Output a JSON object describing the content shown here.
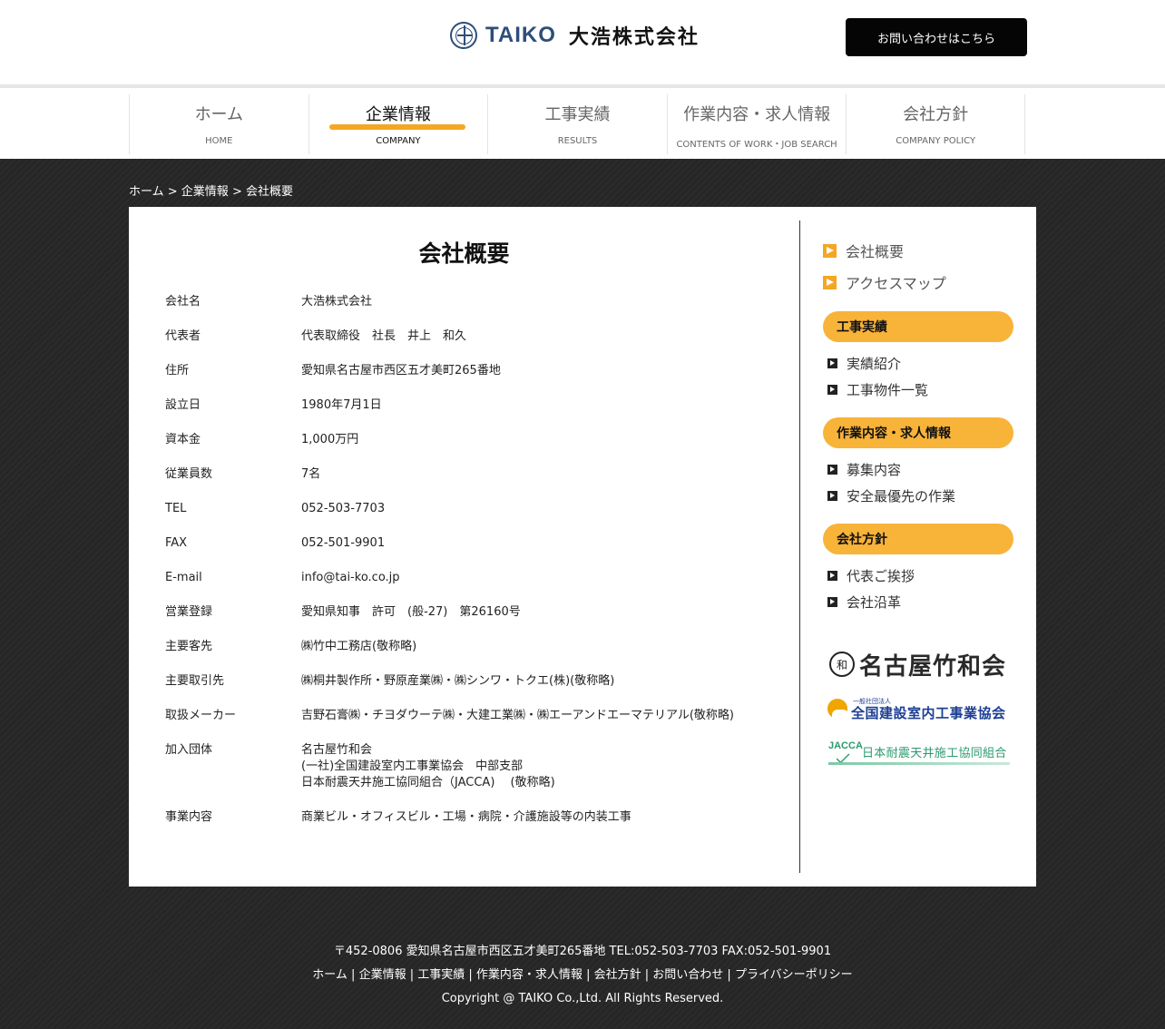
{
  "header": {
    "logo_en": "TAIKO",
    "logo_jp": "大浩株式会社",
    "contact_label": "お問い合わせはこちら"
  },
  "nav": [
    {
      "jp": "ホーム",
      "en": "HOME",
      "active": false
    },
    {
      "jp": "企業情報",
      "en": "COMPANY",
      "active": true
    },
    {
      "jp": "工事実績",
      "en": "RESULTS",
      "active": false
    },
    {
      "jp": "作業内容・求人情報",
      "en": "CONTENTS OF WORK・JOB SEARCH",
      "active": false
    },
    {
      "jp": "会社方針",
      "en": "COMPANY POLICY",
      "active": false
    }
  ],
  "breadcrumb": {
    "home": "ホーム",
    "sep1": " > ",
    "company": "企業情報",
    "sep2": " > ",
    "current": "会社概要"
  },
  "main": {
    "title": "会社概要",
    "rows": [
      {
        "key": "会社名",
        "value": "大浩株式会社"
      },
      {
        "key": "代表者",
        "value": "代表取締役　社長　井上　和久"
      },
      {
        "key": "住所",
        "value": "愛知県名古屋市西区五才美町265番地"
      },
      {
        "key": "設立日",
        "value": "1980年7月1日"
      },
      {
        "key": "資本金",
        "value": "1,000万円"
      },
      {
        "key": "従業員数",
        "value": "7名"
      },
      {
        "key": "TEL",
        "value": "052-503-7703"
      },
      {
        "key": "FAX",
        "value": "052-501-9901"
      },
      {
        "key": "E-mail",
        "value": "info@tai-ko.co.jp"
      },
      {
        "key": "営業登録",
        "value": "愛知県知事　許可　(般-27)　第26160号"
      },
      {
        "key": "主要客先",
        "value": "㈱竹中工務店(敬称略)"
      },
      {
        "key": "主要取引先",
        "value": "㈱桐井製作所・野原産業㈱・㈱シンワ・トクエ(株)(敬称略)"
      },
      {
        "key": "取扱メーカー",
        "value": "吉野石膏㈱・チヨダウーテ㈱・大建工業㈱・㈱エーアンドエーマテリアル(敬称略)"
      },
      {
        "key": "加入団体",
        "value": "名古屋竹和会",
        "value2": "(一社)全国建設室内工事業協会　中部支部",
        "value3": "日本耐震天井施工協同組合（JACCA)　 (敬称略)"
      },
      {
        "key": "事業内容",
        "value": "商業ビル・オフィスビル・工場・病院・介護施設等の内装工事"
      }
    ]
  },
  "sidebar": {
    "top_links": [
      "会社概要",
      "アクセスマップ"
    ],
    "sections": [
      {
        "heading": "工事実績",
        "links": [
          "実績紹介",
          "工事物件一覧"
        ]
      },
      {
        "heading": "作業内容・求人情報",
        "links": [
          "募集内容",
          "安全最優先の作業"
        ]
      },
      {
        "heading": "会社方針",
        "links": [
          "代表ご挨拶",
          "会社沿革"
        ]
      }
    ],
    "badges": {
      "b1_mark": "和",
      "b1_text": "名古屋竹和会",
      "b2_small": "一般社団法人",
      "b2_text": "全国建設室内工事業協会",
      "b3_jacca": "JACCA",
      "b3_text": "日本耐震天井施工協同組合"
    }
  },
  "footer": {
    "address": "〒452-0806 愛知県名古屋市西区五才美町265番地 TEL:052-503-7703 FAX:052-501-9901",
    "links": [
      "ホーム",
      "企業情報",
      "工事実績",
      "作業内容・求人情報",
      "会社方針",
      "お問い合わせ",
      "プライバシーポリシー"
    ],
    "separator": " | ",
    "copyright": "Copyright @ TAIKO Co.,Ltd. All Rights Reserved."
  }
}
